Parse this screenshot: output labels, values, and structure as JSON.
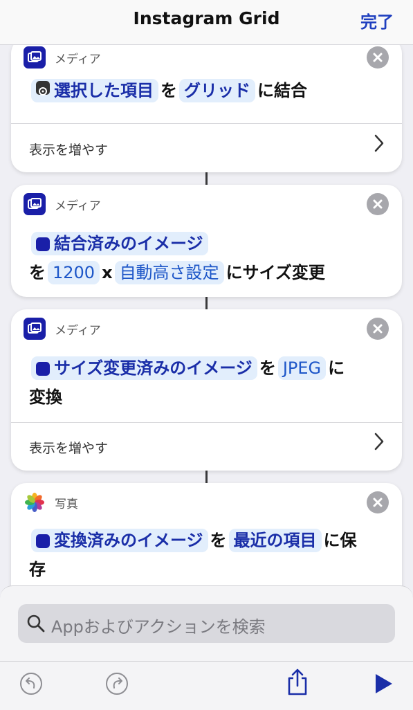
{
  "header": {
    "title": "Instagram Grid",
    "done_label": "完了"
  },
  "actions": [
    {
      "category": "メディア",
      "parts": {
        "token1": "選択した項目",
        "t1": "を",
        "token2": "グリッド",
        "t2": "に結合"
      },
      "more_label": "表示を増やす"
    },
    {
      "category": "メディア",
      "parts": {
        "token1": "結合済みのイメージ",
        "t1": "を",
        "token2": "1200",
        "t2": "x",
        "token3": "自動高さ設定",
        "t3": "にサイズ変更"
      }
    },
    {
      "category": "メディア",
      "parts": {
        "token1": "サイズ変更済みのイメージ",
        "t1": "を",
        "token2": "JPEG",
        "t2": "に",
        "t3": "変換"
      },
      "more_label": "表示を増やす"
    },
    {
      "category": "写真",
      "parts": {
        "token1": "変換済みのイメージ",
        "t1": "を",
        "token2": "最近の項目",
        "t2": "に保",
        "t3": "存"
      }
    }
  ],
  "search": {
    "placeholder": "Appおよびアクションを検索"
  },
  "colors": {
    "accent": "#1f3fbf",
    "token_bg": "#e2eefc",
    "media_icon": "#1a1fa8"
  }
}
